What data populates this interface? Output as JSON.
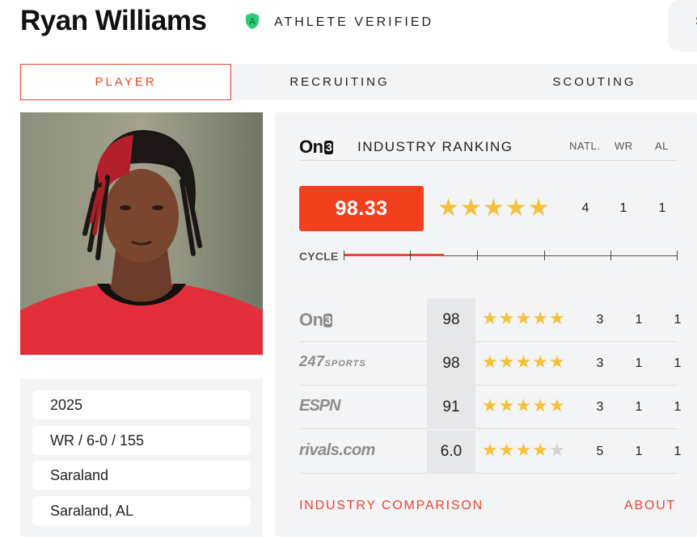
{
  "player": {
    "name": "Ryan Williams",
    "badge_letter": "A",
    "verified_label": "ATHLETE VERIFIED"
  },
  "search": {
    "stub_text": "S"
  },
  "tabs": [
    {
      "label": "PLAYER",
      "active": true
    },
    {
      "label": "RECRUITING",
      "active": false
    },
    {
      "label": "SCOUTING",
      "active": false
    }
  ],
  "info": {
    "class_year": "2025",
    "position_measurables": "WR / 6-0 / 155",
    "school": "Saraland",
    "hometown": "Saraland, AL"
  },
  "ranking": {
    "brand_text": "On",
    "brand_box": "3",
    "title": "INDUSTRY RANKING",
    "col_headers": [
      "NATL.",
      "WR",
      "AL"
    ],
    "score": "98.33",
    "stars": 5,
    "natl": "4",
    "pos": "1",
    "state": "1",
    "cycle_label": "CYCLE",
    "cycle_progress": 0.3
  },
  "services": [
    {
      "name": "On3",
      "logo": "on3",
      "logo_text": "On",
      "logo_box": "3",
      "score": "98",
      "stars": 5,
      "natl": "3",
      "pos": "1",
      "state": "1"
    },
    {
      "name": "247Sports",
      "logo": "247",
      "logo_text": "247",
      "logo_small": "SPORTS",
      "score": "98",
      "stars": 5,
      "natl": "3",
      "pos": "1",
      "state": "1"
    },
    {
      "name": "ESPN",
      "logo": "espn",
      "logo_text": "ESPN",
      "score": "91",
      "stars": 5,
      "natl": "3",
      "pos": "1",
      "state": "1"
    },
    {
      "name": "Rivals",
      "logo": "rivals",
      "logo_text": "rivals.com",
      "score": "6.0",
      "stars": 4,
      "natl": "5",
      "pos": "1",
      "state": "1"
    }
  ],
  "footer": {
    "comparison_label": "INDUSTRY COMPARISON",
    "about_label": "ABOUT"
  },
  "colors": {
    "accent": "#e8452c",
    "score_bg": "#f2401f",
    "star": "#f5c13b",
    "star_off": "#d2d2d2",
    "panel_bg": "#f3f4f6",
    "badge_green": "#2ecc71"
  }
}
